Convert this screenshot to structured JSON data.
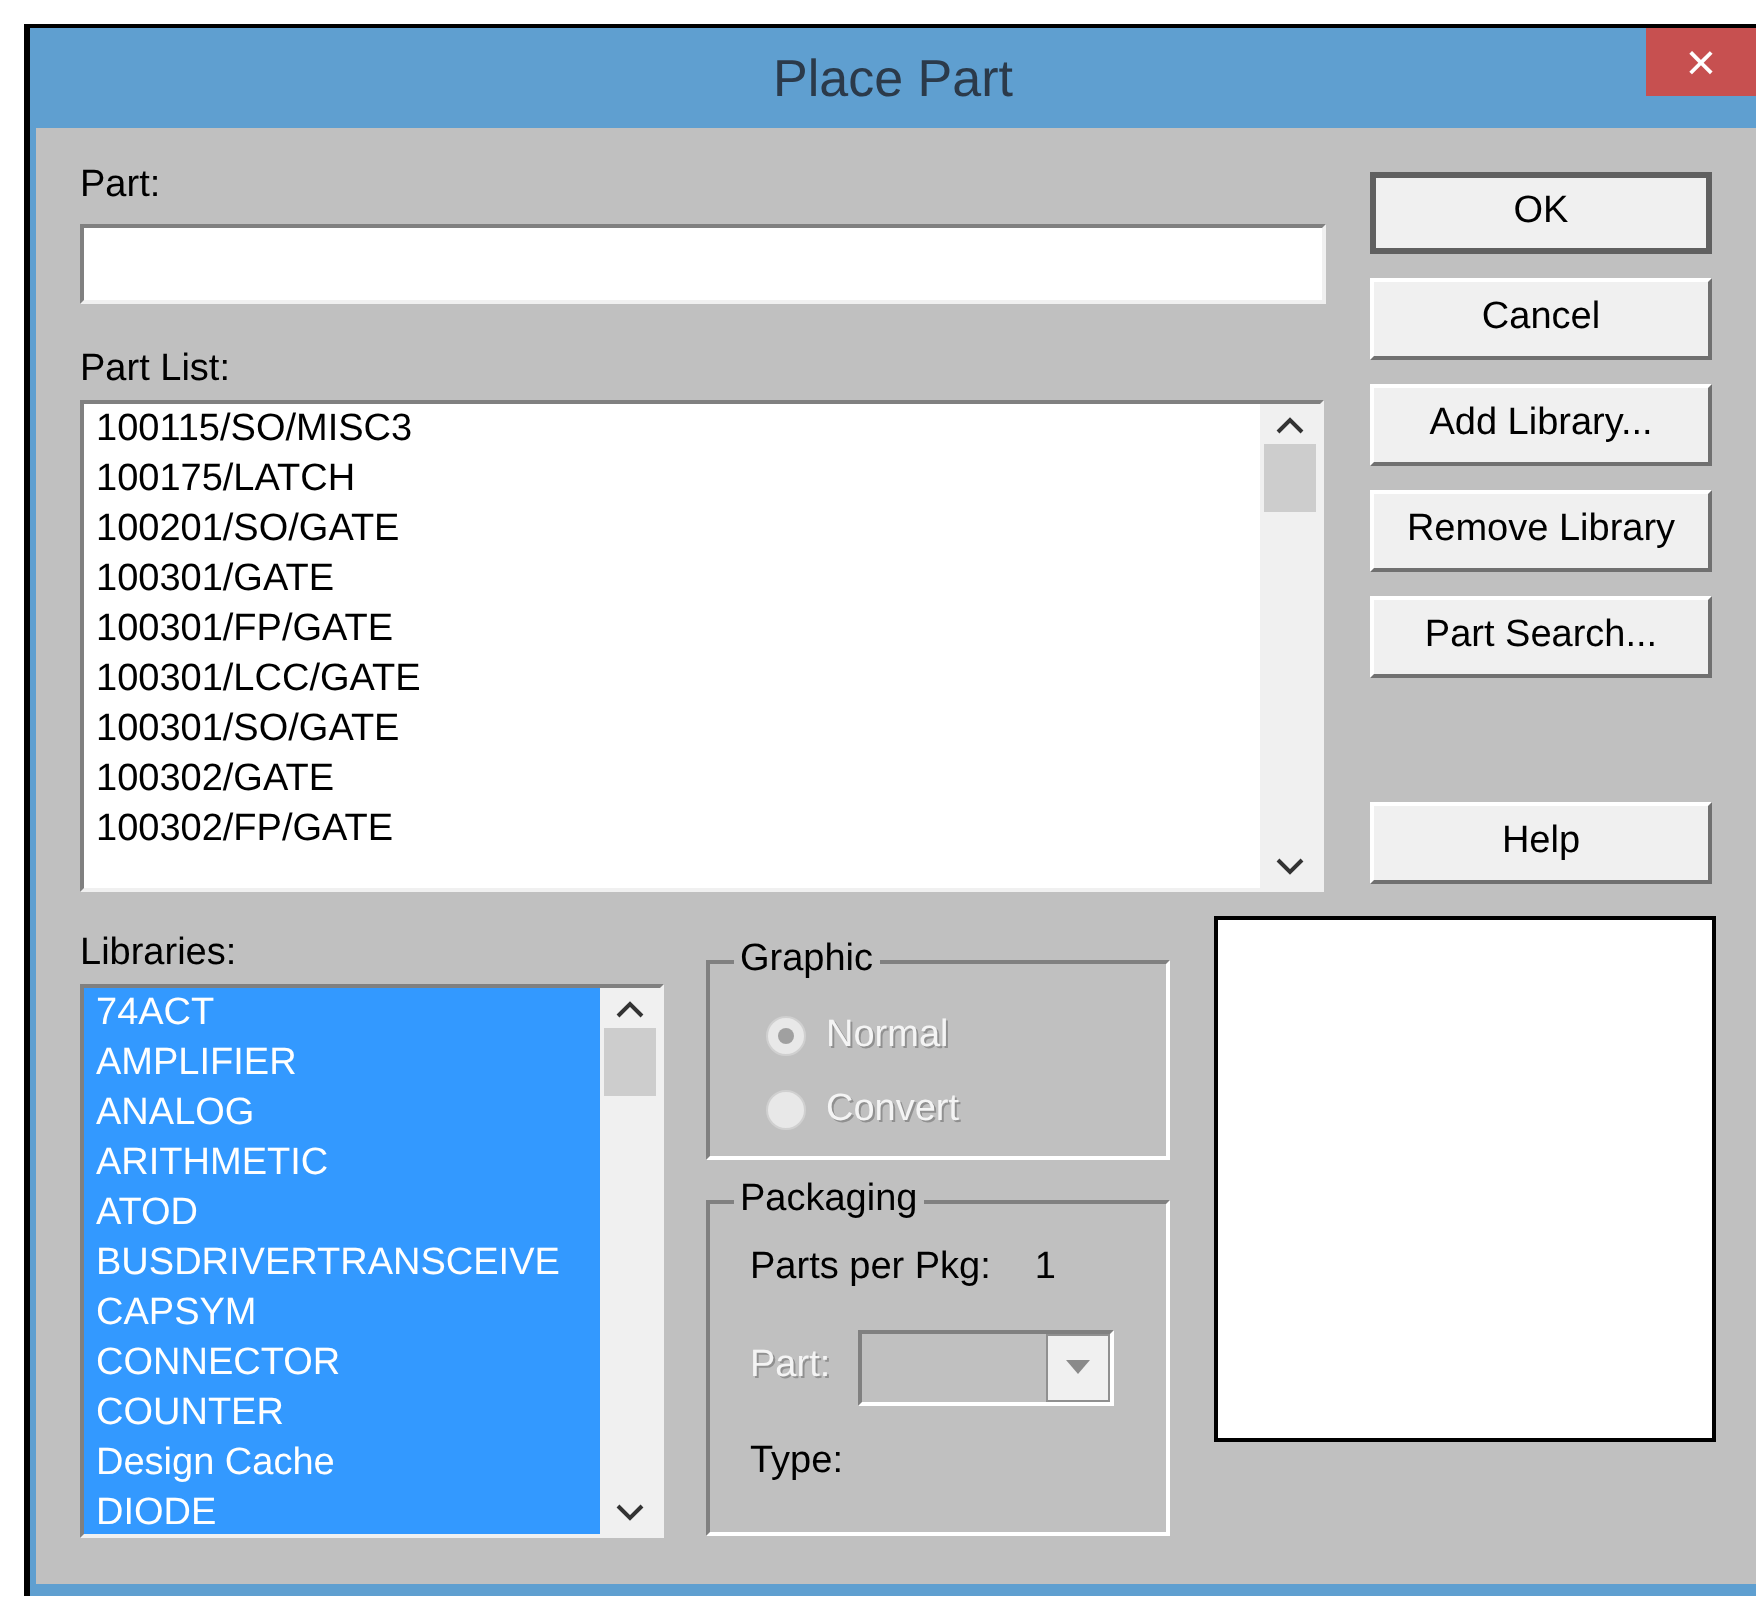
{
  "window": {
    "title": "Place Part",
    "close": "×"
  },
  "part": {
    "label": "Part:"
  },
  "part_list": {
    "label": "Part List:",
    "items": [
      {
        "text": "100115/SO/MISC3",
        "selected": false
      },
      {
        "text": "100175/LATCH",
        "selected": false
      },
      {
        "text": "100201/SO/GATE",
        "selected": false
      },
      {
        "text": "100301/GATE",
        "selected": false
      },
      {
        "text": "100301/FP/GATE",
        "selected": false
      },
      {
        "text": "100301/LCC/GATE",
        "selected": false
      },
      {
        "text": "100301/SO/GATE",
        "selected": false
      },
      {
        "text": "100302/GATE",
        "selected": false
      },
      {
        "text": "100302/FP/GATE",
        "selected": false
      }
    ]
  },
  "buttons": [
    {
      "label": "OK",
      "kind": "default"
    },
    {
      "label": "Cancel",
      "kind": "normal"
    },
    {
      "label": "Add Library...",
      "kind": "normal"
    },
    {
      "label": "Remove Library",
      "kind": "normal"
    },
    {
      "label": "Part Search...",
      "kind": "normal"
    },
    {
      "label": "Help",
      "kind": "spaced"
    }
  ],
  "libraries": {
    "label": "Libraries:",
    "items": [
      {
        "text": "74ACT",
        "selected": true
      },
      {
        "text": "AMPLIFIER",
        "selected": true
      },
      {
        "text": "ANALOG",
        "selected": true
      },
      {
        "text": "ARITHMETIC",
        "selected": true
      },
      {
        "text": "ATOD",
        "selected": true
      },
      {
        "text": "BUSDRIVERTRANSCEIVE",
        "selected": true
      },
      {
        "text": "CAPSYM",
        "selected": true
      },
      {
        "text": "CONNECTOR",
        "selected": true
      },
      {
        "text": "COUNTER",
        "selected": true
      },
      {
        "text": "Design Cache",
        "selected": true
      },
      {
        "text": "DIODE",
        "selected": true
      }
    ]
  },
  "graphic": {
    "title": "Graphic",
    "disabled": true,
    "options": [
      {
        "label": "Normal",
        "selected": true
      },
      {
        "label": "Convert",
        "selected": false
      }
    ]
  },
  "packaging": {
    "title": "Packaging",
    "parts_per_pkg_label": "Parts per Pkg:",
    "parts_per_pkg": "1",
    "part_label": "Part:",
    "part_disabled": true,
    "type_label": "Type:"
  }
}
